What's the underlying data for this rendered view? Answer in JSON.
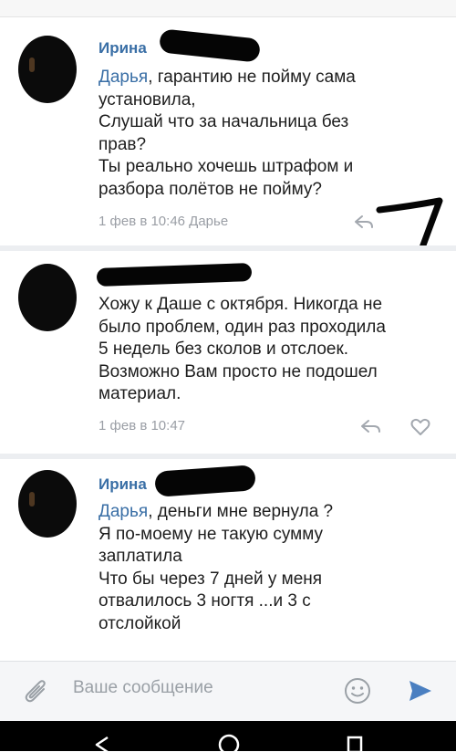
{
  "top_cut_text": "",
  "comments": [
    {
      "author": "Ирина",
      "mention": "Дарья",
      "text": ", гарантию не пойму сама\nустановила,\nСлушай что за начальница без\nправ?\nТы реально хочешь штрафом и\nразбора полётов не пойму?",
      "meta": "1 фев в 10:46 Дарье"
    },
    {
      "author": "",
      "mention": "",
      "text": "Хожу к Даше с октября. Никогда не\nбыло проблем, один раз проходила\n5 недель без сколов и отслоек.\nВозможно Вам просто не подошел\nматериал.",
      "meta": "1 фев в 10:47"
    },
    {
      "author": "Ирина",
      "mention": "Дарья",
      "text": ", деньги мне вернула ?\nЯ по-моему не такую сумму\nзаплатила\nЧто бы через 7 дней у меня\nотвалилось 3 ногтя ...и 3 с\nотслойкой",
      "meta": ""
    }
  ],
  "annotation": "7",
  "composer": {
    "placeholder": "Ваше сообщение"
  },
  "icons": {
    "attach": "paperclip-icon",
    "emoji": "smile-icon",
    "send": "send-icon",
    "reply": "reply-icon",
    "like": "heart-icon"
  },
  "colors": {
    "link": "#3a6fa6",
    "meta": "#9a9ea5",
    "send": "#4a7fc1",
    "separator": "#eceef1"
  }
}
